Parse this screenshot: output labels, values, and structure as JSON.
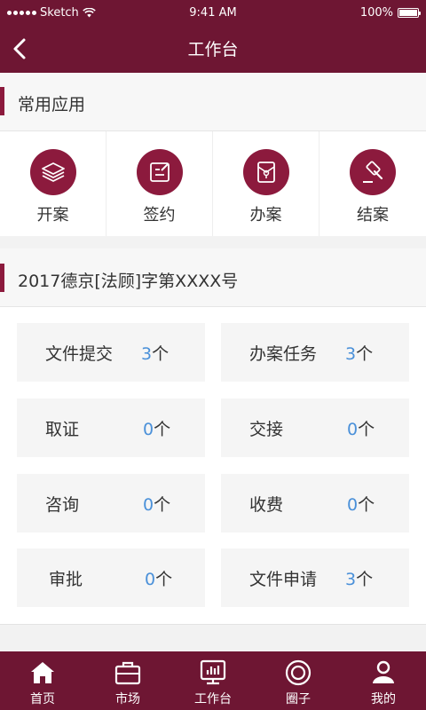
{
  "status_bar": {
    "carrier": "Sketch",
    "time": "9:41 AM",
    "battery": "100%"
  },
  "nav": {
    "title": "工作台",
    "back_icon": "chevron-left-icon"
  },
  "common_apps": {
    "title": "常用应用",
    "items": [
      {
        "label": "开案",
        "icon": "layers-icon"
      },
      {
        "label": "签约",
        "icon": "sign-doc-icon"
      },
      {
        "label": "办案",
        "icon": "case-folder-icon"
      },
      {
        "label": "结案",
        "icon": "gavel-icon"
      }
    ]
  },
  "case": {
    "title": "2017德京[法顾]字第XXXX号",
    "stats": [
      {
        "name": "文件提交",
        "num": "3",
        "unit": "个"
      },
      {
        "name": "办案任务",
        "num": "3",
        "unit": "个"
      },
      {
        "name": "取证",
        "num": "0",
        "unit": "个"
      },
      {
        "name": "交接",
        "num": "0",
        "unit": "个"
      },
      {
        "name": "咨询",
        "num": "0",
        "unit": "个"
      },
      {
        "name": "收费",
        "num": "0",
        "unit": "个"
      },
      {
        "name": "审批",
        "num": "0",
        "unit": "个"
      },
      {
        "name": "文件申请",
        "num": "3",
        "unit": "个"
      }
    ]
  },
  "tabbar": {
    "items": [
      {
        "label": "首页",
        "icon": "home-icon"
      },
      {
        "label": "市场",
        "icon": "briefcase-icon"
      },
      {
        "label": "工作台",
        "icon": "monitor-chart-icon",
        "active": true
      },
      {
        "label": "圈子",
        "icon": "circle-ring-icon"
      },
      {
        "label": "我的",
        "icon": "user-icon"
      }
    ]
  },
  "colors": {
    "brand": "#6e1633",
    "accent": "#8c1a3d",
    "number": "#4a90d9"
  }
}
